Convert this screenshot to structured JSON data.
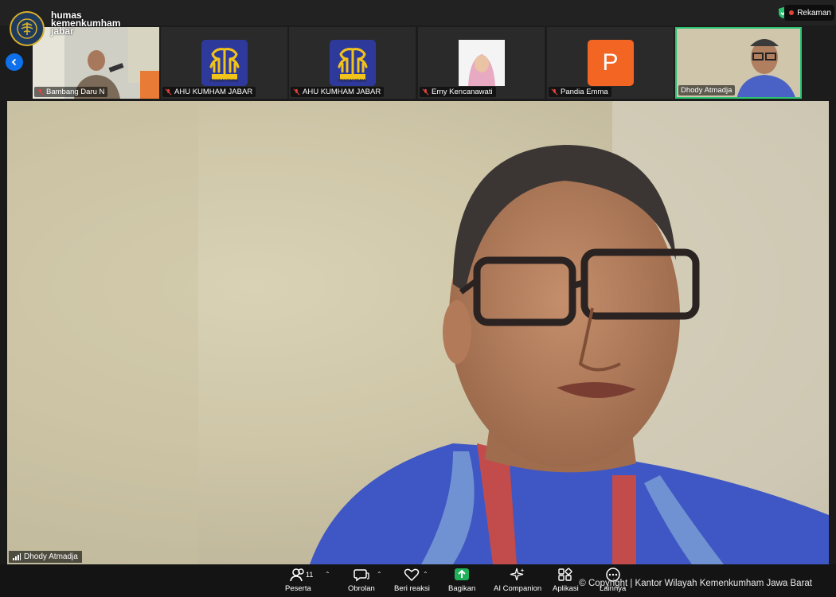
{
  "brand": {
    "line1": "humas",
    "line2": "kemenkumham",
    "line3": "jabar"
  },
  "recording": {
    "label": "Rekaman"
  },
  "participants": [
    {
      "name": "Bambang Daru N",
      "type": "video",
      "muted": true
    },
    {
      "name": "AHU KUMHAM JABAR",
      "type": "logo",
      "muted": true,
      "logo_text": "PENGAYOMAN"
    },
    {
      "name": "AHU KUMHAM JABAR",
      "type": "logo",
      "muted": true,
      "logo_text": "PENGAYOMAN"
    },
    {
      "name": "Erny Kencanawati",
      "type": "photo",
      "muted": true
    },
    {
      "name": "Pandia Emma",
      "type": "initial",
      "initial": "P",
      "muted": true
    },
    {
      "name": "Dhody Atmadja",
      "type": "video",
      "muted": false,
      "active": true
    }
  ],
  "main_video": {
    "speaker_name": "Dhody Atmadja"
  },
  "toolbar": {
    "participants_label": "Peserta",
    "participants_count": "11",
    "chat_label": "Obrolan",
    "reactions_label": "Beri reaksi",
    "share_label": "Bagikan",
    "ai_label": "AI Companion",
    "apps_label": "Aplikasi",
    "more_label": "Lainnya"
  },
  "copyright": "© Copyright | Kantor Wilayah Kemenkumham Jawa Barat",
  "colors": {
    "accent_blue": "#0e71eb",
    "active_border": "#2bc371",
    "share_green": "#1fb15a",
    "record_red": "#e0453a",
    "logo_blue": "#2d3a9c",
    "pandia_orange": "#f26522"
  }
}
